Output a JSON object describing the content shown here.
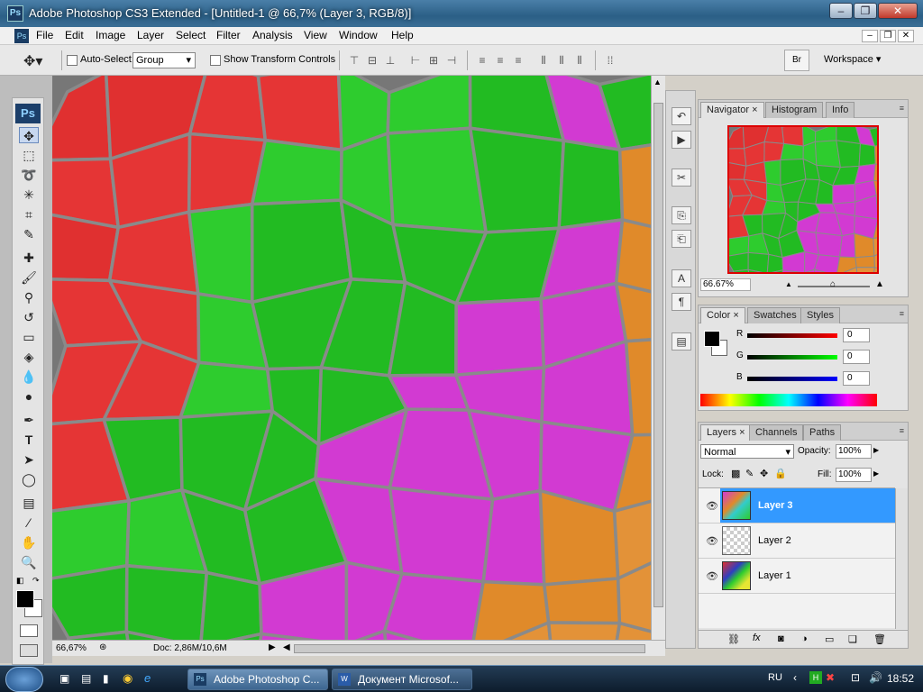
{
  "window": {
    "title": "Adobe Photoshop CS3 Extended - [Untitled-1 @ 66,7% (Layer 3, RGB/8)]",
    "minimize": "–",
    "restore": "❐",
    "close": "✕"
  },
  "menubar": {
    "items": [
      "File",
      "Edit",
      "Image",
      "Layer",
      "Select",
      "Filter",
      "Analysis",
      "View",
      "Window",
      "Help"
    ]
  },
  "options": {
    "auto_select_label": "Auto-Select:",
    "auto_select_value": "Group",
    "show_transform_label": "Show Transform Controls",
    "workspace_label": "Workspace"
  },
  "status": {
    "zoom": "66,67%",
    "doc": "Doc: 2,86M/10,6M"
  },
  "navigator": {
    "tabs": [
      "Navigator",
      "Histogram",
      "Info"
    ],
    "zoom": "66.67%"
  },
  "color_panel": {
    "tabs": [
      "Color",
      "Swatches",
      "Styles"
    ],
    "r_label": "R",
    "g_label": "G",
    "b_label": "B",
    "r": "0",
    "g": "0",
    "b": "0"
  },
  "layers_panel": {
    "tabs": [
      "Layers",
      "Channels",
      "Paths"
    ],
    "blend_mode": "Normal",
    "opacity_label": "Opacity:",
    "opacity": "100%",
    "lock_label": "Lock:",
    "fill_label": "Fill:",
    "fill": "100%",
    "layers": [
      "Layer 3",
      "Layer 2",
      "Layer 1"
    ],
    "selected_color": "#3399ff"
  },
  "taskbar": {
    "task1": "Adobe Photoshop C...",
    "task2": "Документ Microsof...",
    "lang": "RU",
    "time": "18:52"
  },
  "tile_colors": [
    "#e03030",
    "#e53535",
    "#2ecc2e",
    "#22bb22",
    "#d23ad2",
    "#e08a2a",
    "#e39238",
    "#dcd23a",
    "#e6e633",
    "#2e3ec0",
    "#3a4ad0",
    "#33cccc",
    "#40d8d8",
    "#ee2222"
  ]
}
